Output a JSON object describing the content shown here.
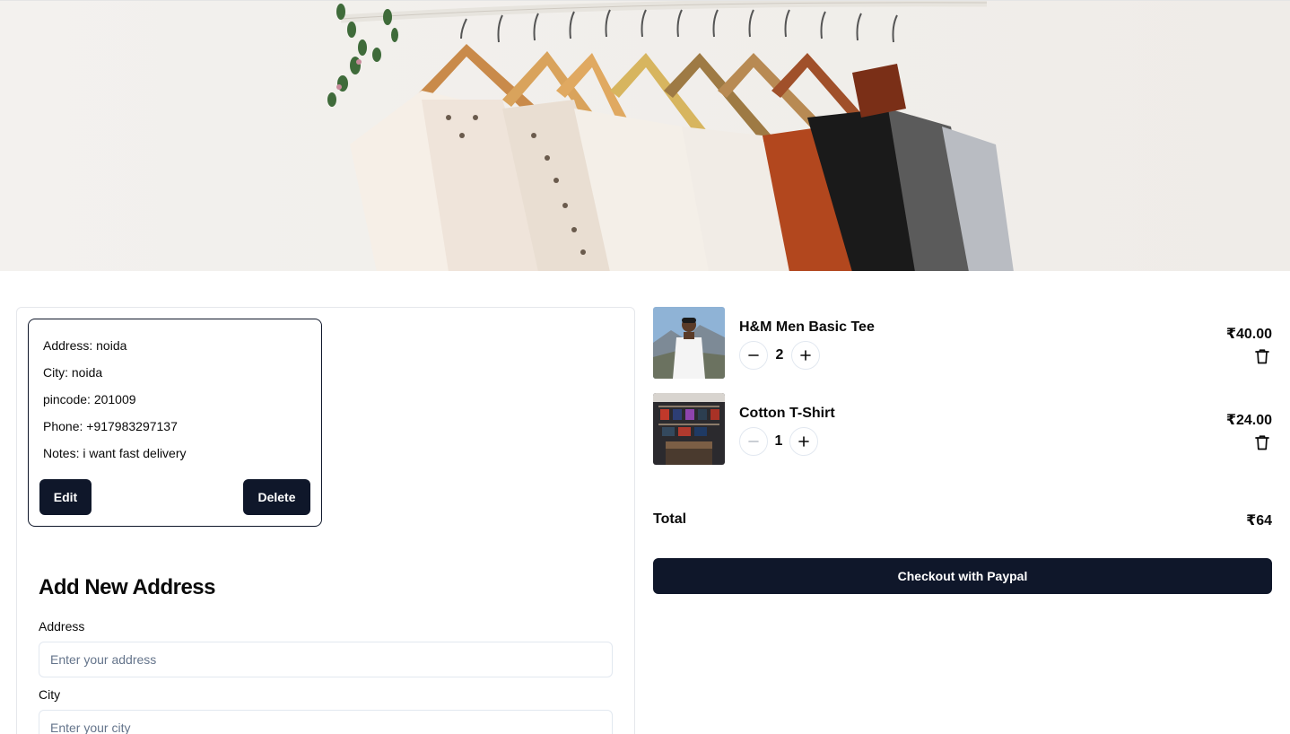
{
  "address_card": {
    "address": "Address: noida",
    "city": "City: noida",
    "pincode": "pincode: 201009",
    "phone": "Phone: +917983297137",
    "notes": "Notes: i want fast delivery",
    "edit_label": "Edit",
    "delete_label": "Delete"
  },
  "address_form": {
    "title": "Add New Address",
    "address_label": "Address",
    "address_placeholder": "Enter your address",
    "city_label": "City",
    "city_placeholder": "Enter your city"
  },
  "cart": {
    "items": [
      {
        "name": "H&M Men Basic Tee",
        "quantity": "2",
        "price": "₹40.00"
      },
      {
        "name": "Cotton T-Shirt",
        "quantity": "1",
        "price": "₹24.00"
      }
    ],
    "total_label": "Total",
    "total_value": "₹64",
    "checkout_label": "Checkout with Paypal"
  },
  "colors": {
    "primary_dark": "#0f172a",
    "border": "#e2e8f0",
    "placeholder": "#64748b"
  },
  "icons": [
    "minus-icon",
    "plus-icon",
    "trash-icon"
  ]
}
